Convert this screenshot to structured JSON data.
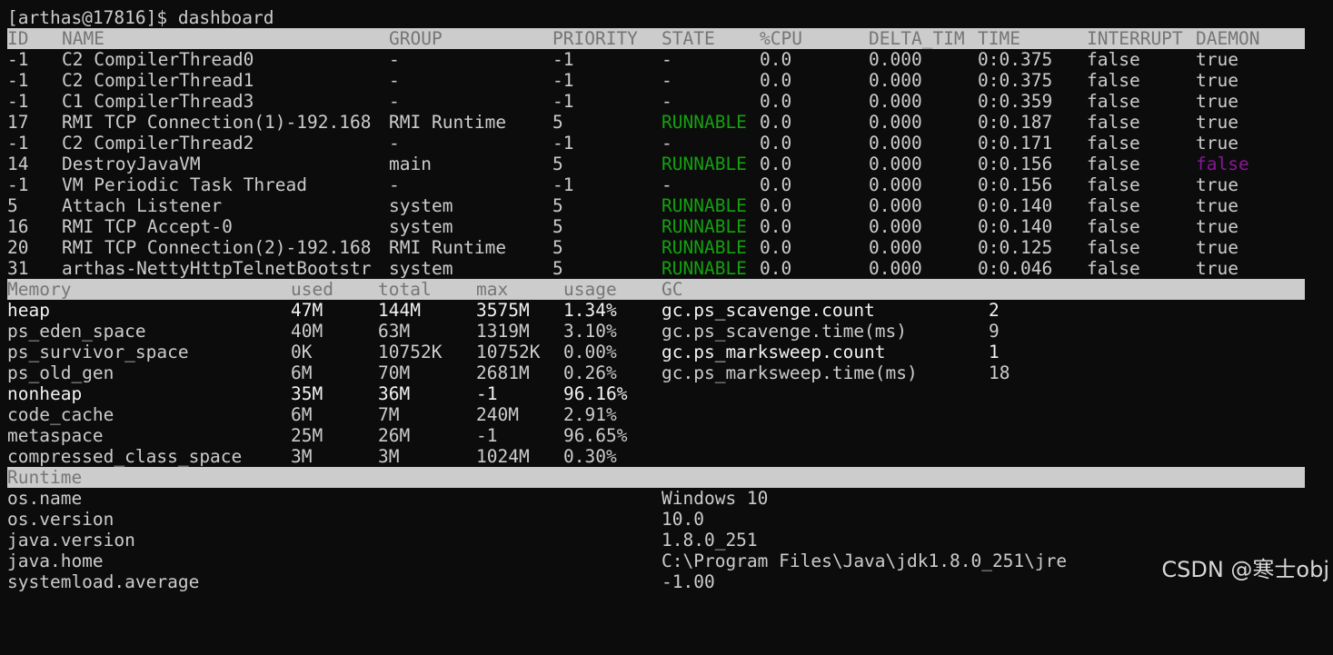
{
  "prompt": "[arthas@17816]$ dashboard",
  "threads": {
    "headers": {
      "id": "ID",
      "name": "NAME",
      "group": "GROUP",
      "priority": "PRIORITY",
      "state": "STATE",
      "cpu": "%CPU",
      "delta": "DELTA_TIM",
      "time": "TIME",
      "interrupt": "INTERRUPT",
      "daemon": "DAEMON"
    },
    "rows": [
      {
        "id": "-1",
        "name": "C2 CompilerThread0",
        "group": "-",
        "priority": "-1",
        "state": "-",
        "cpu": "0.0",
        "delta": "0.000",
        "time": "0:0.375",
        "interrupt": "false",
        "daemon": "true"
      },
      {
        "id": "-1",
        "name": "C2 CompilerThread1",
        "group": "-",
        "priority": "-1",
        "state": "-",
        "cpu": "0.0",
        "delta": "0.000",
        "time": "0:0.375",
        "interrupt": "false",
        "daemon": "true"
      },
      {
        "id": "-1",
        "name": "C1 CompilerThread3",
        "group": "-",
        "priority": "-1",
        "state": "-",
        "cpu": "0.0",
        "delta": "0.000",
        "time": "0:0.359",
        "interrupt": "false",
        "daemon": "true"
      },
      {
        "id": "17",
        "name": "RMI TCP Connection(1)-192.168",
        "group": "RMI Runtime",
        "priority": "5",
        "state": "RUNNABLE",
        "cpu": "0.0",
        "delta": "0.000",
        "time": "0:0.187",
        "interrupt": "false",
        "daemon": "true"
      },
      {
        "id": "-1",
        "name": "C2 CompilerThread2",
        "group": "-",
        "priority": "-1",
        "state": "-",
        "cpu": "0.0",
        "delta": "0.000",
        "time": "0:0.171",
        "interrupt": "false",
        "daemon": "true"
      },
      {
        "id": "14",
        "name": "DestroyJavaVM",
        "group": "main",
        "priority": "5",
        "state": "RUNNABLE",
        "cpu": "0.0",
        "delta": "0.000",
        "time": "0:0.156",
        "interrupt": "false",
        "daemon": "false"
      },
      {
        "id": "-1",
        "name": "VM Periodic Task Thread",
        "group": "-",
        "priority": "-1",
        "state": "-",
        "cpu": "0.0",
        "delta": "0.000",
        "time": "0:0.156",
        "interrupt": "false",
        "daemon": "true"
      },
      {
        "id": "5",
        "name": "Attach Listener",
        "group": "system",
        "priority": "5",
        "state": "RUNNABLE",
        "cpu": "0.0",
        "delta": "0.000",
        "time": "0:0.140",
        "interrupt": "false",
        "daemon": "true"
      },
      {
        "id": "16",
        "name": "RMI TCP Accept-0",
        "group": "system",
        "priority": "5",
        "state": "RUNNABLE",
        "cpu": "0.0",
        "delta": "0.000",
        "time": "0:0.140",
        "interrupt": "false",
        "daemon": "true"
      },
      {
        "id": "20",
        "name": "RMI TCP Connection(2)-192.168",
        "group": "RMI Runtime",
        "priority": "5",
        "state": "RUNNABLE",
        "cpu": "0.0",
        "delta": "0.000",
        "time": "0:0.125",
        "interrupt": "false",
        "daemon": "true"
      },
      {
        "id": "31",
        "name": "arthas-NettyHttpTelnetBootstr",
        "group": "system",
        "priority": "5",
        "state": "RUNNABLE",
        "cpu": "0.0",
        "delta": "0.000",
        "time": "0:0.046",
        "interrupt": "false",
        "daemon": "true"
      }
    ]
  },
  "memory": {
    "headers": {
      "name": "Memory",
      "used": "used",
      "total": "total",
      "max": "max",
      "usage": "usage",
      "gc": "GC"
    },
    "rows": [
      {
        "name": "heap",
        "used": "47M",
        "total": "144M",
        "max": "3575M",
        "usage": "1.34%"
      },
      {
        "name": "ps_eden_space",
        "used": "40M",
        "total": "63M",
        "max": "1319M",
        "usage": "3.10%"
      },
      {
        "name": "ps_survivor_space",
        "used": "0K",
        "total": "10752K",
        "max": "10752K",
        "usage": "0.00%"
      },
      {
        "name": "ps_old_gen",
        "used": "6M",
        "total": "70M",
        "max": "2681M",
        "usage": "0.26%"
      },
      {
        "name": "nonheap",
        "used": "35M",
        "total": "36M",
        "max": "-1",
        "usage": "96.16%"
      },
      {
        "name": "code_cache",
        "used": "6M",
        "total": "7M",
        "max": "240M",
        "usage": "2.91%"
      },
      {
        "name": "metaspace",
        "used": "25M",
        "total": "26M",
        "max": "-1",
        "usage": "96.65%"
      },
      {
        "name": "compressed_class_space",
        "used": "3M",
        "total": "3M",
        "max": "1024M",
        "usage": "0.30%"
      }
    ],
    "gc": [
      {
        "key": "gc.ps_scavenge.count",
        "value": "2"
      },
      {
        "key": "gc.ps_scavenge.time(ms)",
        "value": "9"
      },
      {
        "key": "gc.ps_marksweep.count",
        "value": "1"
      },
      {
        "key": "gc.ps_marksweep.time(ms)",
        "value": "18"
      }
    ]
  },
  "runtime": {
    "header": "Runtime",
    "rows": [
      {
        "key": "os.name",
        "value": "Windows 10"
      },
      {
        "key": "os.version",
        "value": "10.0"
      },
      {
        "key": "java.version",
        "value": "1.8.0_251"
      },
      {
        "key": "java.home",
        "value": "C:\\Program Files\\Java\\jdk1.8.0_251\\jre"
      },
      {
        "key": "systemload.average",
        "value": "-1.00"
      }
    ]
  },
  "watermark": "CSDN @寒士obj",
  "colors": {
    "background": "#0c0c0c",
    "foreground": "#cccccc",
    "bright": "#f2f2f2",
    "header_bg": "#cccccc",
    "header_fg": "#767676",
    "runnable": "#13a10e",
    "daemon_false": "#881798"
  }
}
